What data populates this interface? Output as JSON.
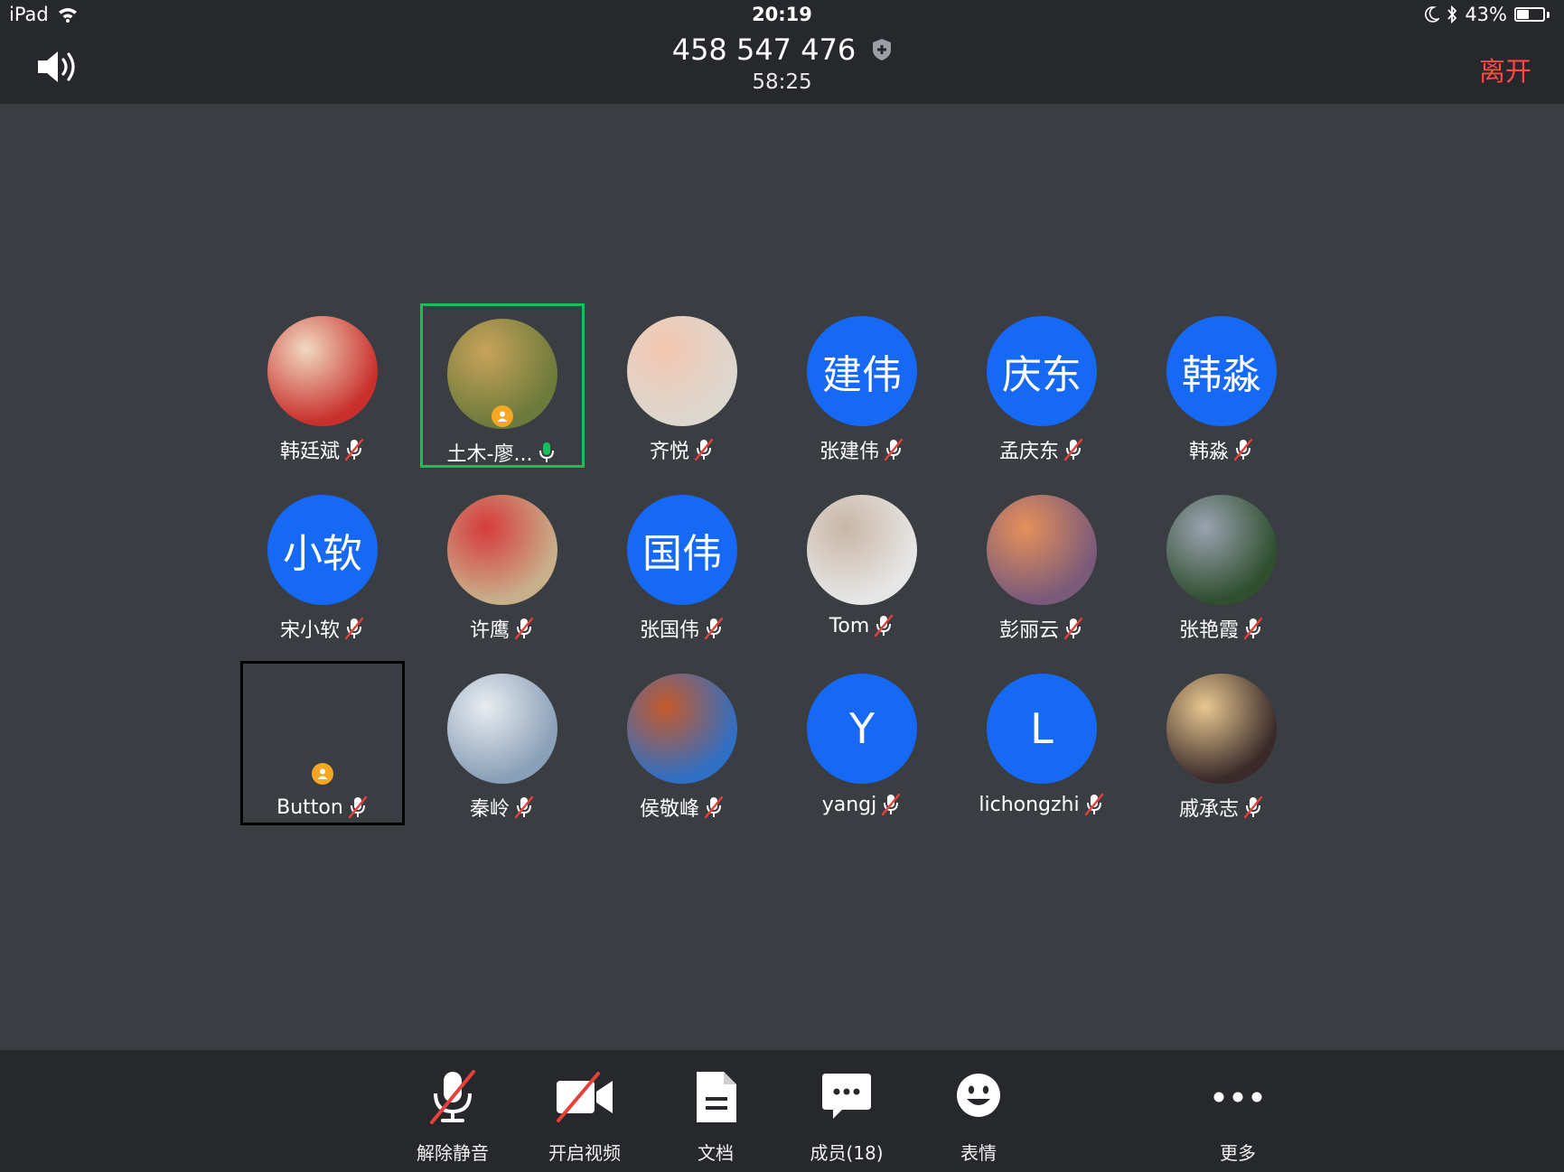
{
  "status_bar": {
    "device": "iPad",
    "time": "20:19",
    "battery_percent": "43%",
    "battery_level": 0.43
  },
  "meeting": {
    "id": "458 547 476",
    "timer": "58:25",
    "leave_label": "离开"
  },
  "participants": [
    {
      "name": "韩廷斌",
      "avatar_type": "photo",
      "mic": "muted",
      "photo_colors": [
        "#c9302c",
        "#f0d9c0"
      ]
    },
    {
      "name": "土木-廖...",
      "avatar_type": "photo",
      "mic": "active",
      "speaking": true,
      "host": true,
      "photo_colors": [
        "#6c7a3b",
        "#c8a35a"
      ]
    },
    {
      "name": "齐悦",
      "avatar_type": "photo",
      "mic": "muted",
      "photo_colors": [
        "#dcd7cf",
        "#f3c7b0"
      ]
    },
    {
      "name": "张建伟",
      "avatar_type": "text",
      "avatar_text": "建伟",
      "mic": "muted"
    },
    {
      "name": "孟庆东",
      "avatar_type": "text",
      "avatar_text": "庆东",
      "mic": "muted"
    },
    {
      "name": "韩淼",
      "avatar_type": "text",
      "avatar_text": "韩淼",
      "mic": "muted"
    },
    {
      "name": "宋小软",
      "avatar_type": "text",
      "avatar_text": "小软",
      "mic": "muted"
    },
    {
      "name": "许鹰",
      "avatar_type": "photo",
      "mic": "muted",
      "photo_colors": [
        "#c8b08a",
        "#d63b3b"
      ]
    },
    {
      "name": "张国伟",
      "avatar_type": "text",
      "avatar_text": "国伟",
      "mic": "muted"
    },
    {
      "name": "Tom",
      "avatar_type": "photo",
      "mic": "muted",
      "photo_colors": [
        "#e6e6e6",
        "#c9b6a5"
      ]
    },
    {
      "name": "彭丽云",
      "avatar_type": "photo",
      "mic": "muted",
      "photo_colors": [
        "#7a5a7a",
        "#e6905a"
      ]
    },
    {
      "name": "张艳霞",
      "avatar_type": "photo",
      "mic": "muted",
      "photo_colors": [
        "#2f4f2f",
        "#9aa3b0"
      ]
    },
    {
      "name": "Button",
      "avatar_type": "none",
      "mic": "muted",
      "selected": true,
      "host": true
    },
    {
      "name": "秦岭",
      "avatar_type": "photo",
      "mic": "muted",
      "photo_colors": [
        "#8aa0b8",
        "#e8ecf0"
      ]
    },
    {
      "name": "侯敬峰",
      "avatar_type": "photo",
      "mic": "muted",
      "photo_colors": [
        "#2f6fc4",
        "#c65a2a"
      ]
    },
    {
      "name": "yangj",
      "avatar_type": "letter",
      "avatar_text": "Y",
      "mic": "muted"
    },
    {
      "name": "lichongzhi",
      "avatar_type": "letter",
      "avatar_text": "L",
      "mic": "muted"
    },
    {
      "name": "戚承志",
      "avatar_type": "photo",
      "mic": "muted",
      "photo_colors": [
        "#3a2a2a",
        "#e8c890"
      ]
    }
  ],
  "toolbar": [
    {
      "key": "unmute",
      "label": "解除静音",
      "icon": "mic-muted-icon"
    },
    {
      "key": "video",
      "label": "开启视频",
      "icon": "video-off-icon"
    },
    {
      "key": "docs",
      "label": "文档",
      "icon": "document-icon"
    },
    {
      "key": "members",
      "label": "成员(18)",
      "icon": "chat-bubble-icon"
    },
    {
      "key": "emoji",
      "label": "表情",
      "icon": "smiley-icon"
    },
    {
      "key": "more",
      "label": "更多",
      "icon": "more-dots-icon"
    }
  ],
  "colors": {
    "background": "#3a3d42",
    "bars": "#26282b",
    "avatar_blue": "#1669f5",
    "speaking_border": "#14c05a",
    "leave_red": "#ff4a46",
    "host_badge": "#f5a623"
  }
}
